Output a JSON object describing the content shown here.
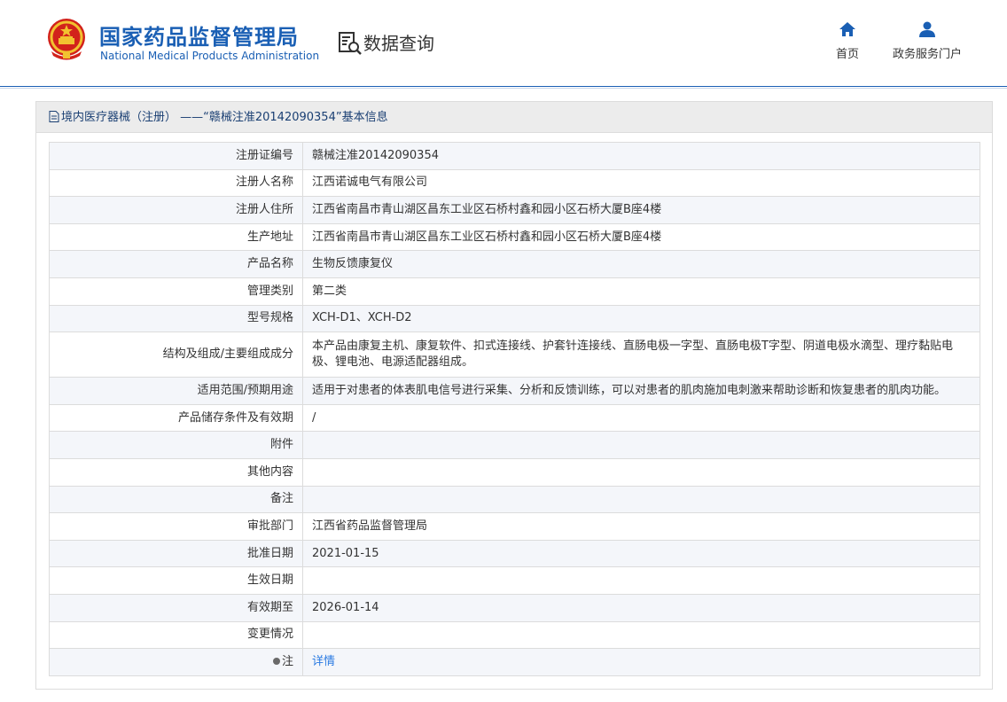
{
  "header": {
    "agency_cn": "国家药品监督管理局",
    "agency_en": "National Medical Products Administration",
    "section_title": "数据查询",
    "nav": [
      {
        "label": "首页",
        "icon": "home-icon"
      },
      {
        "label": "政务服务门户",
        "icon": "user-icon"
      }
    ]
  },
  "panel": {
    "title": "境内医疗器械（注册） ——“赣械注准20142090354”基本信息"
  },
  "rows": [
    {
      "label": "注册证编号",
      "value": "赣械注准20142090354"
    },
    {
      "label": "注册人名称",
      "value": "江西诺诚电气有限公司"
    },
    {
      "label": "注册人住所",
      "value": "江西省南昌市青山湖区昌东工业区石桥村鑫和园小区石桥大厦B座4楼"
    },
    {
      "label": "生产地址",
      "value": "江西省南昌市青山湖区昌东工业区石桥村鑫和园小区石桥大厦B座4楼"
    },
    {
      "label": "产品名称",
      "value": "生物反馈康复仪"
    },
    {
      "label": "管理类别",
      "value": "第二类"
    },
    {
      "label": "型号规格",
      "value": "XCH-D1、XCH-D2"
    },
    {
      "label": "结构及组成/主要组成成分",
      "value": "本产品由康复主机、康复软件、扣式连接线、护套针连接线、直肠电极一字型、直肠电极T字型、阴道电极水滴型、理疗黏贴电极、锂电池、电源适配器组成。"
    },
    {
      "label": "适用范围/预期用途",
      "value": "适用于对患者的体表肌电信号进行采集、分析和反馈训练，可以对患者的肌肉施加电刺激来帮助诊断和恢复患者的肌肉功能。"
    },
    {
      "label": "产品储存条件及有效期",
      "value": "/"
    },
    {
      "label": "附件",
      "value": ""
    },
    {
      "label": "其他内容",
      "value": ""
    },
    {
      "label": "备注",
      "value": ""
    },
    {
      "label": "审批部门",
      "value": "江西省药品监督管理局"
    },
    {
      "label": "批准日期",
      "value": "2021-01-15"
    },
    {
      "label": "生效日期",
      "value": ""
    },
    {
      "label": "有效期至",
      "value": "2026-01-14"
    },
    {
      "label": "变更情况",
      "value": ""
    },
    {
      "label": "注",
      "value": "详情"
    }
  ],
  "colors": {
    "brand_blue": "#1a5fb4",
    "link_blue": "#2a7ae2",
    "emblem_red": "#d2221b",
    "emblem_gold": "#f2c230"
  }
}
